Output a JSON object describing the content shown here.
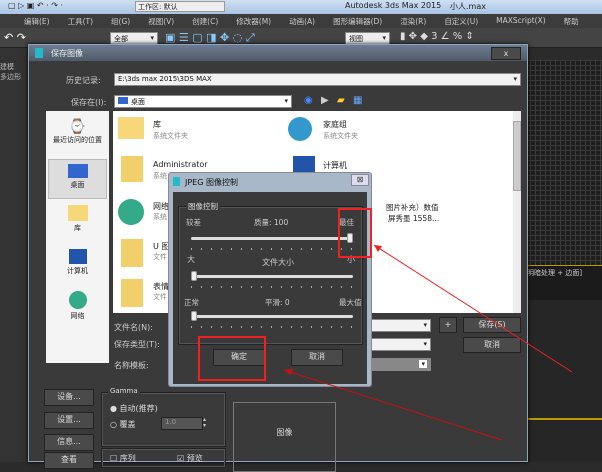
{
  "app": {
    "title": "Autodesk 3ds Max  2015",
    "file": "小人.max",
    "workspace": "工作区: 默认",
    "menu": [
      "编辑(E)",
      "工具(T)",
      "组(G)",
      "视图(V)",
      "创建(C)",
      "修改器(M)",
      "动画(A)",
      "图形编辑器(D)",
      "渲染(R)",
      "自定义(U)",
      "MAXScript(X)",
      "帮助"
    ],
    "toolbar": {
      "filter": "全部",
      "view": "视图"
    },
    "viewport_label": "明暗处理 + 边面]",
    "tabs": [
      "建模",
      "多边形"
    ]
  },
  "save_dialog": {
    "title": "保存图像",
    "close": "x",
    "history_label": "历史记录:",
    "history_value": "E:\\3ds max 2015\\3DS MAX",
    "save_in_label": "保存在(I):",
    "save_in_value": "桌面",
    "places": [
      {
        "label": "最近访问的位置",
        "icon": "recent-icon"
      },
      {
        "label": "桌面",
        "icon": "desktop-icon"
      },
      {
        "label": "库",
        "icon": "library-icon"
      },
      {
        "label": "计算机",
        "icon": "computer-icon"
      },
      {
        "label": "网络",
        "icon": "network-icon"
      }
    ],
    "files": [
      {
        "name": "库",
        "sub": "系统文件夹"
      },
      {
        "name": "家庭组",
        "sub": "系统文件夹"
      },
      {
        "name": "Administrator",
        "sub": "系统"
      },
      {
        "name": "计算机",
        "sub": ""
      },
      {
        "name": "网络",
        "sub": "系统"
      },
      {
        "name": "U 图",
        "sub": "文件"
      },
      {
        "name": "表情",
        "sub": "文件"
      }
    ],
    "file_extra": [
      "图片补充）数值",
      "屏秀墨 1558..."
    ],
    "filename_label": "文件名(N):",
    "type_label": "保存类型(T):",
    "template_label": "名称模板:",
    "plus": "+",
    "save": "保存(S)",
    "cancel": "取消",
    "devices": "设备...",
    "setup": "设置...",
    "info": "信息...",
    "view": "查看",
    "gamma": {
      "title": "Gamma",
      "auto": "自动(推荐)",
      "override": "覆盖",
      "value": "1.0"
    },
    "image": "图像",
    "sequence": "序列",
    "preview": "预览",
    "preview_checked": true
  },
  "jpeg_dialog": {
    "title": "JPEG 图像控制",
    "group": "图像控制",
    "quality": {
      "low": "较差",
      "label": "质量: 100",
      "high": "最佳",
      "value": 100
    },
    "filesize": {
      "low": "大",
      "label": "文件大小",
      "high": "小",
      "value": 0
    },
    "smoothing": {
      "low": "正常",
      "label": "平滑: 0",
      "high": "最大值",
      "value": 0
    },
    "ok": "确定",
    "cancel": "取消"
  },
  "colors": {
    "annotation": "#e22222",
    "dialog_bg": "#3a3a3a"
  }
}
